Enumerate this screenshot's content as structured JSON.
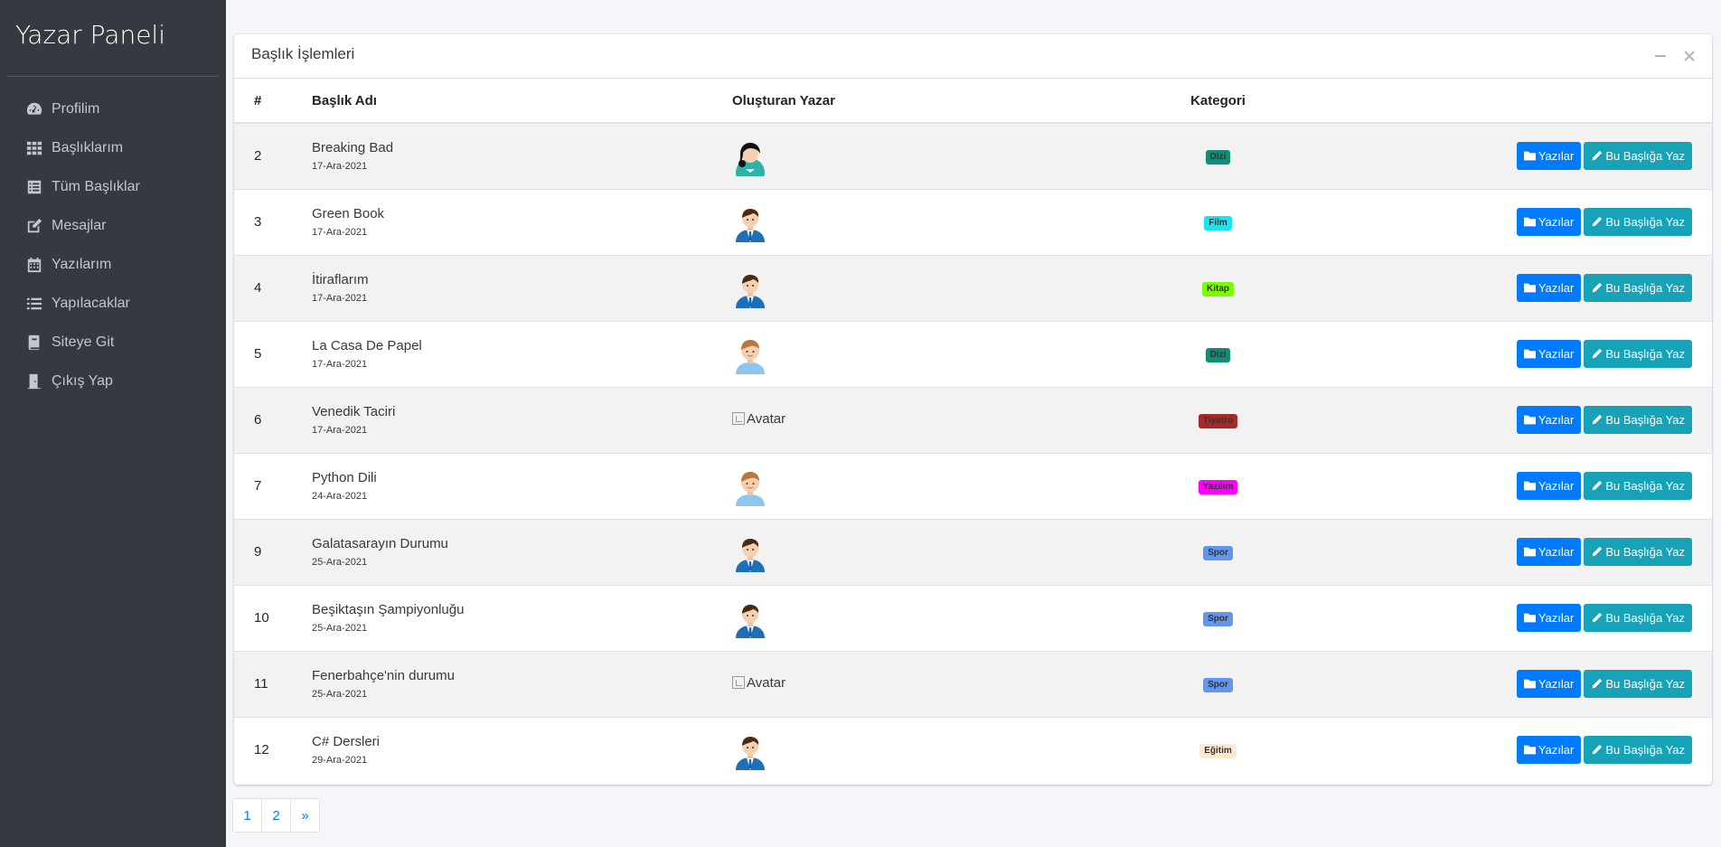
{
  "sidebar": {
    "brand": "Yazar Paneli",
    "items": [
      {
        "label": "Profilim",
        "icon": "dashboard-gauge-icon"
      },
      {
        "label": "Başlıklarım",
        "icon": "grid-icon"
      },
      {
        "label": "Tüm Başlıklar",
        "icon": "list-alt-icon"
      },
      {
        "label": "Mesajlar",
        "icon": "edit-icon"
      },
      {
        "label": "Yazılarım",
        "icon": "calendar-icon"
      },
      {
        "label": "Yapılacaklar",
        "icon": "list-icon"
      },
      {
        "label": "Siteye Git",
        "icon": "book-icon"
      },
      {
        "label": "Çıkış Yap",
        "icon": "door-exit-icon"
      }
    ]
  },
  "card": {
    "title": "Başlık İşlemleri",
    "tools": [
      "minus-icon",
      "close-icon"
    ]
  },
  "table": {
    "headers": {
      "num": "#",
      "title": "Başlık Adı",
      "author": "Oluşturan Yazar",
      "category": "Kategori"
    },
    "rows": [
      {
        "num": "2",
        "title": "Breaking Bad",
        "date": "17-Ara-2021",
        "avatar": "woman",
        "category": "Dizi",
        "cat_bg": "#138d75",
        "cat_fg": "#333333"
      },
      {
        "num": "3",
        "title": "Green Book",
        "date": "17-Ara-2021",
        "avatar": "man-suit",
        "category": "Film",
        "cat_bg": "#17e6f0",
        "cat_fg": "#333333"
      },
      {
        "num": "4",
        "title": "İtiraflarım",
        "date": "17-Ara-2021",
        "avatar": "man-suit",
        "category": "Kitap",
        "cat_bg": "#7cfc00",
        "cat_fg": "#333333"
      },
      {
        "num": "5",
        "title": "La Casa De Papel",
        "date": "17-Ara-2021",
        "avatar": "boy",
        "category": "Dizi",
        "cat_bg": "#138d75",
        "cat_fg": "#333333"
      },
      {
        "num": "6",
        "title": "Venedik Taciri",
        "date": "17-Ara-2021",
        "avatar": "broken",
        "category": "Tiyatro",
        "cat_bg": "#a52a2a",
        "cat_fg": "#333333"
      },
      {
        "num": "7",
        "title": "Python Dili",
        "date": "24-Ara-2021",
        "avatar": "boy",
        "category": "Yazılım",
        "cat_bg": "#ff00ff",
        "cat_fg": "#333333"
      },
      {
        "num": "9",
        "title": "Galatasarayın Durumu",
        "date": "25-Ara-2021",
        "avatar": "man-suit",
        "category": "Spor",
        "cat_bg": "#6495ed",
        "cat_fg": "#333333"
      },
      {
        "num": "10",
        "title": "Beşiktaşın Şampiyonluğu",
        "date": "25-Ara-2021",
        "avatar": "man-suit",
        "category": "Spor",
        "cat_bg": "#6495ed",
        "cat_fg": "#333333"
      },
      {
        "num": "11",
        "title": "Fenerbahçe'nin durumu",
        "date": "25-Ara-2021",
        "avatar": "broken",
        "category": "Spor",
        "cat_bg": "#6495ed",
        "cat_fg": "#333333"
      },
      {
        "num": "12",
        "title": "C# Dersleri",
        "date": "29-Ara-2021",
        "avatar": "man-suit",
        "category": "Eğitim",
        "cat_bg": "#fde9d0",
        "cat_fg": "#333333"
      }
    ],
    "avatar_alt": "Avatar",
    "btn_posts": "Yazılar",
    "btn_write": "Bu Başlığa Yaz"
  },
  "pagination": [
    "1",
    "2",
    "»"
  ]
}
